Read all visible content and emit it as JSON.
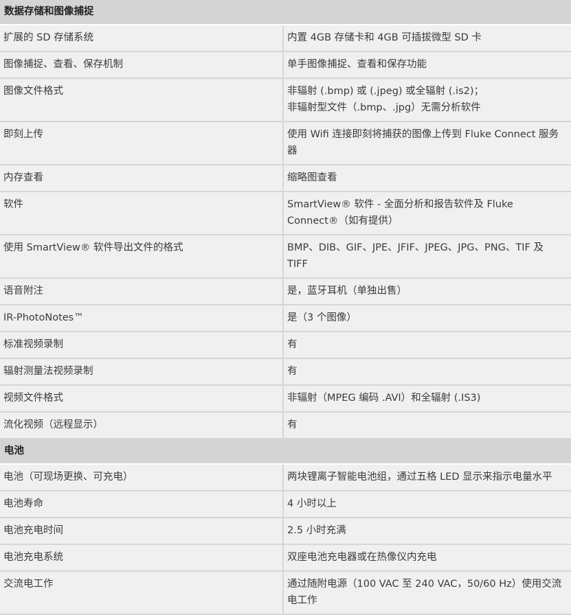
{
  "sections": [
    {
      "title": "数据存储和图像捕捉",
      "rows": [
        {
          "label": "扩展的 SD 存储系统",
          "value": "内置 4GB 存储卡和 4GB 可插拔微型 SD 卡"
        },
        {
          "label": "图像捕捉、查看、保存机制",
          "value": "单手图像捕捉、查看和保存功能"
        },
        {
          "label": "图像文件格式",
          "value": "非辐射 (.bmp) 或 (.jpeg) 或全辐射 (.is2)；\n非辐射型文件（.bmp、.jpg）无需分析软件"
        },
        {
          "label": "即刻上传",
          "value": "使用 Wifi 连接即刻将捕获的图像上传到 Fluke Connect 服务器"
        },
        {
          "label": "内存查看",
          "value": "缩略图查看"
        },
        {
          "label": "软件",
          "value": "SmartView® 软件 - 全面分析和报告软件及 Fluke Connect®（如有提供）"
        },
        {
          "label": "使用 SmartView® 软件导出文件的格式",
          "value": "BMP、DIB、GIF、JPE、JFIF、JPEG、JPG、PNG、TIF 及 TIFF"
        },
        {
          "label": "语音附注",
          "value": "是，蓝牙耳机（单独出售）"
        },
        {
          "label": "IR-PhotoNotes™",
          "value": "是（3 个图像）"
        },
        {
          "label": "标准视频录制",
          "value": "有"
        },
        {
          "label": "辐射测量法视频录制",
          "value": "有"
        },
        {
          "label": "视频文件格式",
          "value": "非辐射（MPEG 编码 .AVI）和全辐射 (.IS3)"
        },
        {
          "label": "流化视频（远程显示）",
          "value": "有"
        }
      ]
    },
    {
      "title": "电池",
      "rows": [
        {
          "label": "电池（可现场更换、可充电）",
          "value": "两块锂离子智能电池组，通过五格 LED 显示来指示电量水平"
        },
        {
          "label": "电池寿命",
          "value": "4 小时以上"
        },
        {
          "label": "电池充电时间",
          "value": "2.5 小时充满"
        },
        {
          "label": "电池充电系统",
          "value": "双座电池充电器或在热像仪内充电"
        },
        {
          "label": "交流电工作",
          "value": "通过随附电源（100 VAC 至 240 VAC，50/60 Hz）使用交流电工作"
        }
      ]
    }
  ]
}
